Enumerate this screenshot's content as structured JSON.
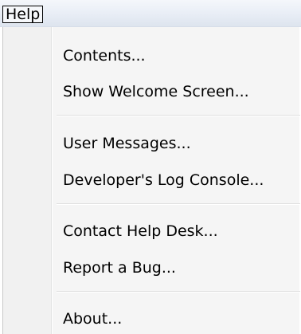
{
  "menubar": {
    "help_label": "Help"
  },
  "menu": {
    "items": [
      {
        "label": "Contents..."
      },
      {
        "label": "Show Welcome Screen..."
      },
      {
        "label": "User Messages..."
      },
      {
        "label": "Developer's Log Console..."
      },
      {
        "label": "Contact Help Desk..."
      },
      {
        "label": "Report a Bug..."
      },
      {
        "label": "About..."
      }
    ]
  }
}
